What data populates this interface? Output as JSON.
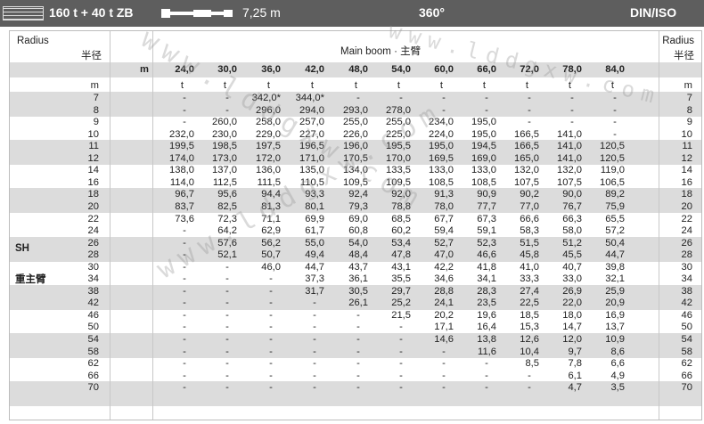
{
  "header": {
    "configuration": "160 t + 40 t ZB",
    "boom_length": "7,25 m",
    "slewing": "360°",
    "norm": "DIN/ISO"
  },
  "table": {
    "radius_label_en": "Radius",
    "radius_label_cn": "半径",
    "radius_label_en_right": "Radius",
    "radius_label_cn_right": "半径",
    "main_boom_label": "Main boom · 主臂",
    "boom_unit": "m",
    "boom_lengths": [
      "24,0",
      "30,0",
      "36,0",
      "42,0",
      "48,0",
      "54,0",
      "60,0",
      "66,0",
      "72,0",
      "78,0",
      "84,0"
    ],
    "radius_unit": "m",
    "load_unit": "t",
    "mode_label": "SH",
    "mode_label_cn": "重主臂",
    "rows": [
      {
        "r": "7",
        "v": [
          "-",
          "-",
          "342,0*",
          "344,0*",
          "-",
          "-",
          "-",
          "-",
          "-",
          "-",
          "-"
        ]
      },
      {
        "r": "8",
        "v": [
          "-",
          "-",
          "296,0",
          "294,0",
          "293,0",
          "278,0",
          "-",
          "-",
          "-",
          "-",
          "-"
        ]
      },
      {
        "r": "9",
        "v": [
          "-",
          "260,0",
          "258,0",
          "257,0",
          "255,0",
          "255,0",
          "234,0",
          "195,0",
          "-",
          "-",
          "-"
        ]
      },
      {
        "r": "10",
        "v": [
          "232,0",
          "230,0",
          "229,0",
          "227,0",
          "226,0",
          "225,0",
          "224,0",
          "195,0",
          "166,5",
          "141,0",
          "-"
        ]
      },
      {
        "r": "11",
        "v": [
          "199,5",
          "198,5",
          "197,5",
          "196,5",
          "196,0",
          "195,5",
          "195,0",
          "194,5",
          "166,5",
          "141,0",
          "120,5"
        ]
      },
      {
        "r": "12",
        "v": [
          "174,0",
          "173,0",
          "172,0",
          "171,0",
          "170,5",
          "170,0",
          "169,5",
          "169,0",
          "165,0",
          "141,0",
          "120,5"
        ]
      },
      {
        "r": "14",
        "v": [
          "138,0",
          "137,0",
          "136,0",
          "135,0",
          "134,0",
          "133,5",
          "133,0",
          "133,0",
          "132,0",
          "132,0",
          "119,0"
        ]
      },
      {
        "r": "16",
        "v": [
          "114,0",
          "112,5",
          "111,5",
          "110,5",
          "109,5",
          "109,5",
          "108,5",
          "108,5",
          "107,5",
          "107,5",
          "106,5"
        ]
      },
      {
        "r": "18",
        "v": [
          "96,7",
          "95,6",
          "94,4",
          "93,3",
          "92,4",
          "92,0",
          "91,3",
          "90,9",
          "90,2",
          "90,0",
          "89,2"
        ]
      },
      {
        "r": "20",
        "v": [
          "83,7",
          "82,5",
          "81,3",
          "80,1",
          "79,3",
          "78,8",
          "78,0",
          "77,7",
          "77,0",
          "76,7",
          "75,9"
        ]
      },
      {
        "r": "22",
        "v": [
          "73,6",
          "72,3",
          "71,1",
          "69,9",
          "69,0",
          "68,5",
          "67,7",
          "67,3",
          "66,6",
          "66,3",
          "65,5"
        ]
      },
      {
        "r": "24",
        "v": [
          "-",
          "64,2",
          "62,9",
          "61,7",
          "60,8",
          "60,2",
          "59,4",
          "59,1",
          "58,3",
          "58,0",
          "57,2"
        ]
      },
      {
        "r": "26",
        "v": [
          "-",
          "57,6",
          "56,2",
          "55,0",
          "54,0",
          "53,4",
          "52,7",
          "52,3",
          "51,5",
          "51,2",
          "50,4"
        ]
      },
      {
        "r": "28",
        "v": [
          "-",
          "52,1",
          "50,7",
          "49,4",
          "48,4",
          "47,8",
          "47,0",
          "46,6",
          "45,8",
          "45,5",
          "44,7"
        ]
      },
      {
        "r": "30",
        "v": [
          "-",
          "-",
          "46,0",
          "44,7",
          "43,7",
          "43,1",
          "42,2",
          "41,8",
          "41,0",
          "40,7",
          "39,8"
        ]
      },
      {
        "r": "34",
        "v": [
          "-",
          "-",
          "-",
          "37,3",
          "36,1",
          "35,5",
          "34,6",
          "34,1",
          "33,3",
          "33,0",
          "32,1"
        ]
      },
      {
        "r": "38",
        "v": [
          "-",
          "-",
          "-",
          "31,7",
          "30,5",
          "29,7",
          "28,8",
          "28,3",
          "27,4",
          "26,9",
          "25,9"
        ]
      },
      {
        "r": "42",
        "v": [
          "-",
          "-",
          "-",
          "-",
          "26,1",
          "25,2",
          "24,1",
          "23,5",
          "22,5",
          "22,0",
          "20,9"
        ]
      },
      {
        "r": "46",
        "v": [
          "-",
          "-",
          "-",
          "-",
          "-",
          "21,5",
          "20,2",
          "19,6",
          "18,5",
          "18,0",
          "16,9"
        ]
      },
      {
        "r": "50",
        "v": [
          "-",
          "-",
          "-",
          "-",
          "-",
          "-",
          "17,1",
          "16,4",
          "15,3",
          "14,7",
          "13,7"
        ]
      },
      {
        "r": "54",
        "v": [
          "-",
          "-",
          "-",
          "-",
          "-",
          "-",
          "14,6",
          "13,8",
          "12,6",
          "12,0",
          "10,9"
        ]
      },
      {
        "r": "58",
        "v": [
          "-",
          "-",
          "-",
          "-",
          "-",
          "-",
          "-",
          "11,6",
          "10,4",
          "9,7",
          "8,6"
        ]
      },
      {
        "r": "62",
        "v": [
          "-",
          "-",
          "-",
          "-",
          "-",
          "-",
          "-",
          "-",
          "8,5",
          "7,8",
          "6,6"
        ]
      },
      {
        "r": "66",
        "v": [
          "-",
          "-",
          "-",
          "-",
          "-",
          "-",
          "-",
          "-",
          "-",
          "6,1",
          "4,9"
        ]
      },
      {
        "r": "70",
        "v": [
          "-",
          "-",
          "-",
          "-",
          "-",
          "-",
          "-",
          "-",
          "-",
          "4,7",
          "3,5"
        ]
      }
    ]
  },
  "watermark": "www.lddgxw.com"
}
